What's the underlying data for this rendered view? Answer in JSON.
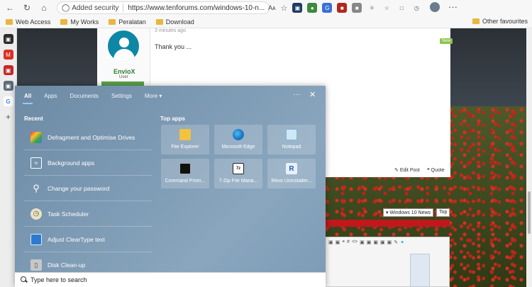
{
  "browser": {
    "security_label": "Added security",
    "url": "https://www.tenforums.com/windows-10-n...",
    "reader_label": "Aᴀ",
    "more_label": "···"
  },
  "bookmarks": {
    "items": [
      "Web Access",
      "My Works",
      "Peralatan",
      "Download"
    ],
    "other": "Other favourites"
  },
  "forum": {
    "username": "EnvioX",
    "role": "User",
    "posted": "3 minutes ago",
    "post_text": "Thank you ...",
    "new_badge": "New",
    "edit_post": "Edit Post",
    "quote": "Quote",
    "nav_forum": "Windows 10 News",
    "nav_top": "Top"
  },
  "start_menu": {
    "tabs": [
      "All",
      "Apps",
      "Documents",
      "Settings",
      "More"
    ],
    "ellipsis": "···",
    "close": "✕",
    "recent_title": "Recent",
    "top_apps_title": "Top apps",
    "recent": [
      {
        "label": "Defragment and Optimise Drives",
        "icon": "defrag-icon"
      },
      {
        "label": "Background apps",
        "icon": "background-apps-icon"
      },
      {
        "label": "Change your password",
        "icon": "key-icon"
      },
      {
        "label": "Task Scheduler",
        "icon": "clock-icon"
      },
      {
        "label": "Adjust ClearType text",
        "icon": "monitor-icon"
      },
      {
        "label": "Disk Clean-up",
        "icon": "disk-cleanup-icon"
      }
    ],
    "top_apps": [
      {
        "label": "File Explorer",
        "icon": "folder-icon"
      },
      {
        "label": "Microsoft Edge",
        "icon": "edge-icon"
      },
      {
        "label": "Notepad",
        "icon": "notepad-icon"
      },
      {
        "label": "Command Prom...",
        "icon": "cmd-icon"
      },
      {
        "label": "7-Zip File Mana...",
        "icon": "zip-icon"
      },
      {
        "label": "Revo Uninstaller...",
        "icon": "revo-icon"
      }
    ]
  },
  "search": {
    "placeholder": "Type here to search"
  }
}
